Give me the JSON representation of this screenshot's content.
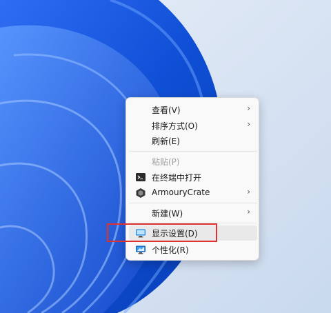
{
  "colors": {
    "menu_bg": "#f9f9f9",
    "text": "#1a1a1a",
    "disabled_text": "#a0a0a0",
    "hover_bg": "#e9e9e9",
    "annotation": "#e03131",
    "wallpaper_blue": "#1a55e0",
    "wallpaper_light": "#d7e4f3"
  },
  "menu": {
    "view": {
      "label": "查看(V)",
      "submenu": true
    },
    "sort": {
      "label": "排序方式(O)",
      "submenu": true
    },
    "refresh": {
      "label": "刷新(E)"
    },
    "paste": {
      "label": "粘贴(P)",
      "disabled": true
    },
    "terminal": {
      "label": "在终端中打开",
      "icon": "terminal-icon"
    },
    "armoury": {
      "label": "ArmouryCrate",
      "icon": "armoury-crate-icon",
      "submenu": true
    },
    "new": {
      "label": "新建(W)",
      "submenu": true
    },
    "display": {
      "label": "显示设置(D)",
      "icon": "display-icon",
      "hovered": true,
      "annotated": true
    },
    "personalize": {
      "label": "个性化(R)",
      "icon": "personalize-icon"
    }
  },
  "chevron": "›"
}
